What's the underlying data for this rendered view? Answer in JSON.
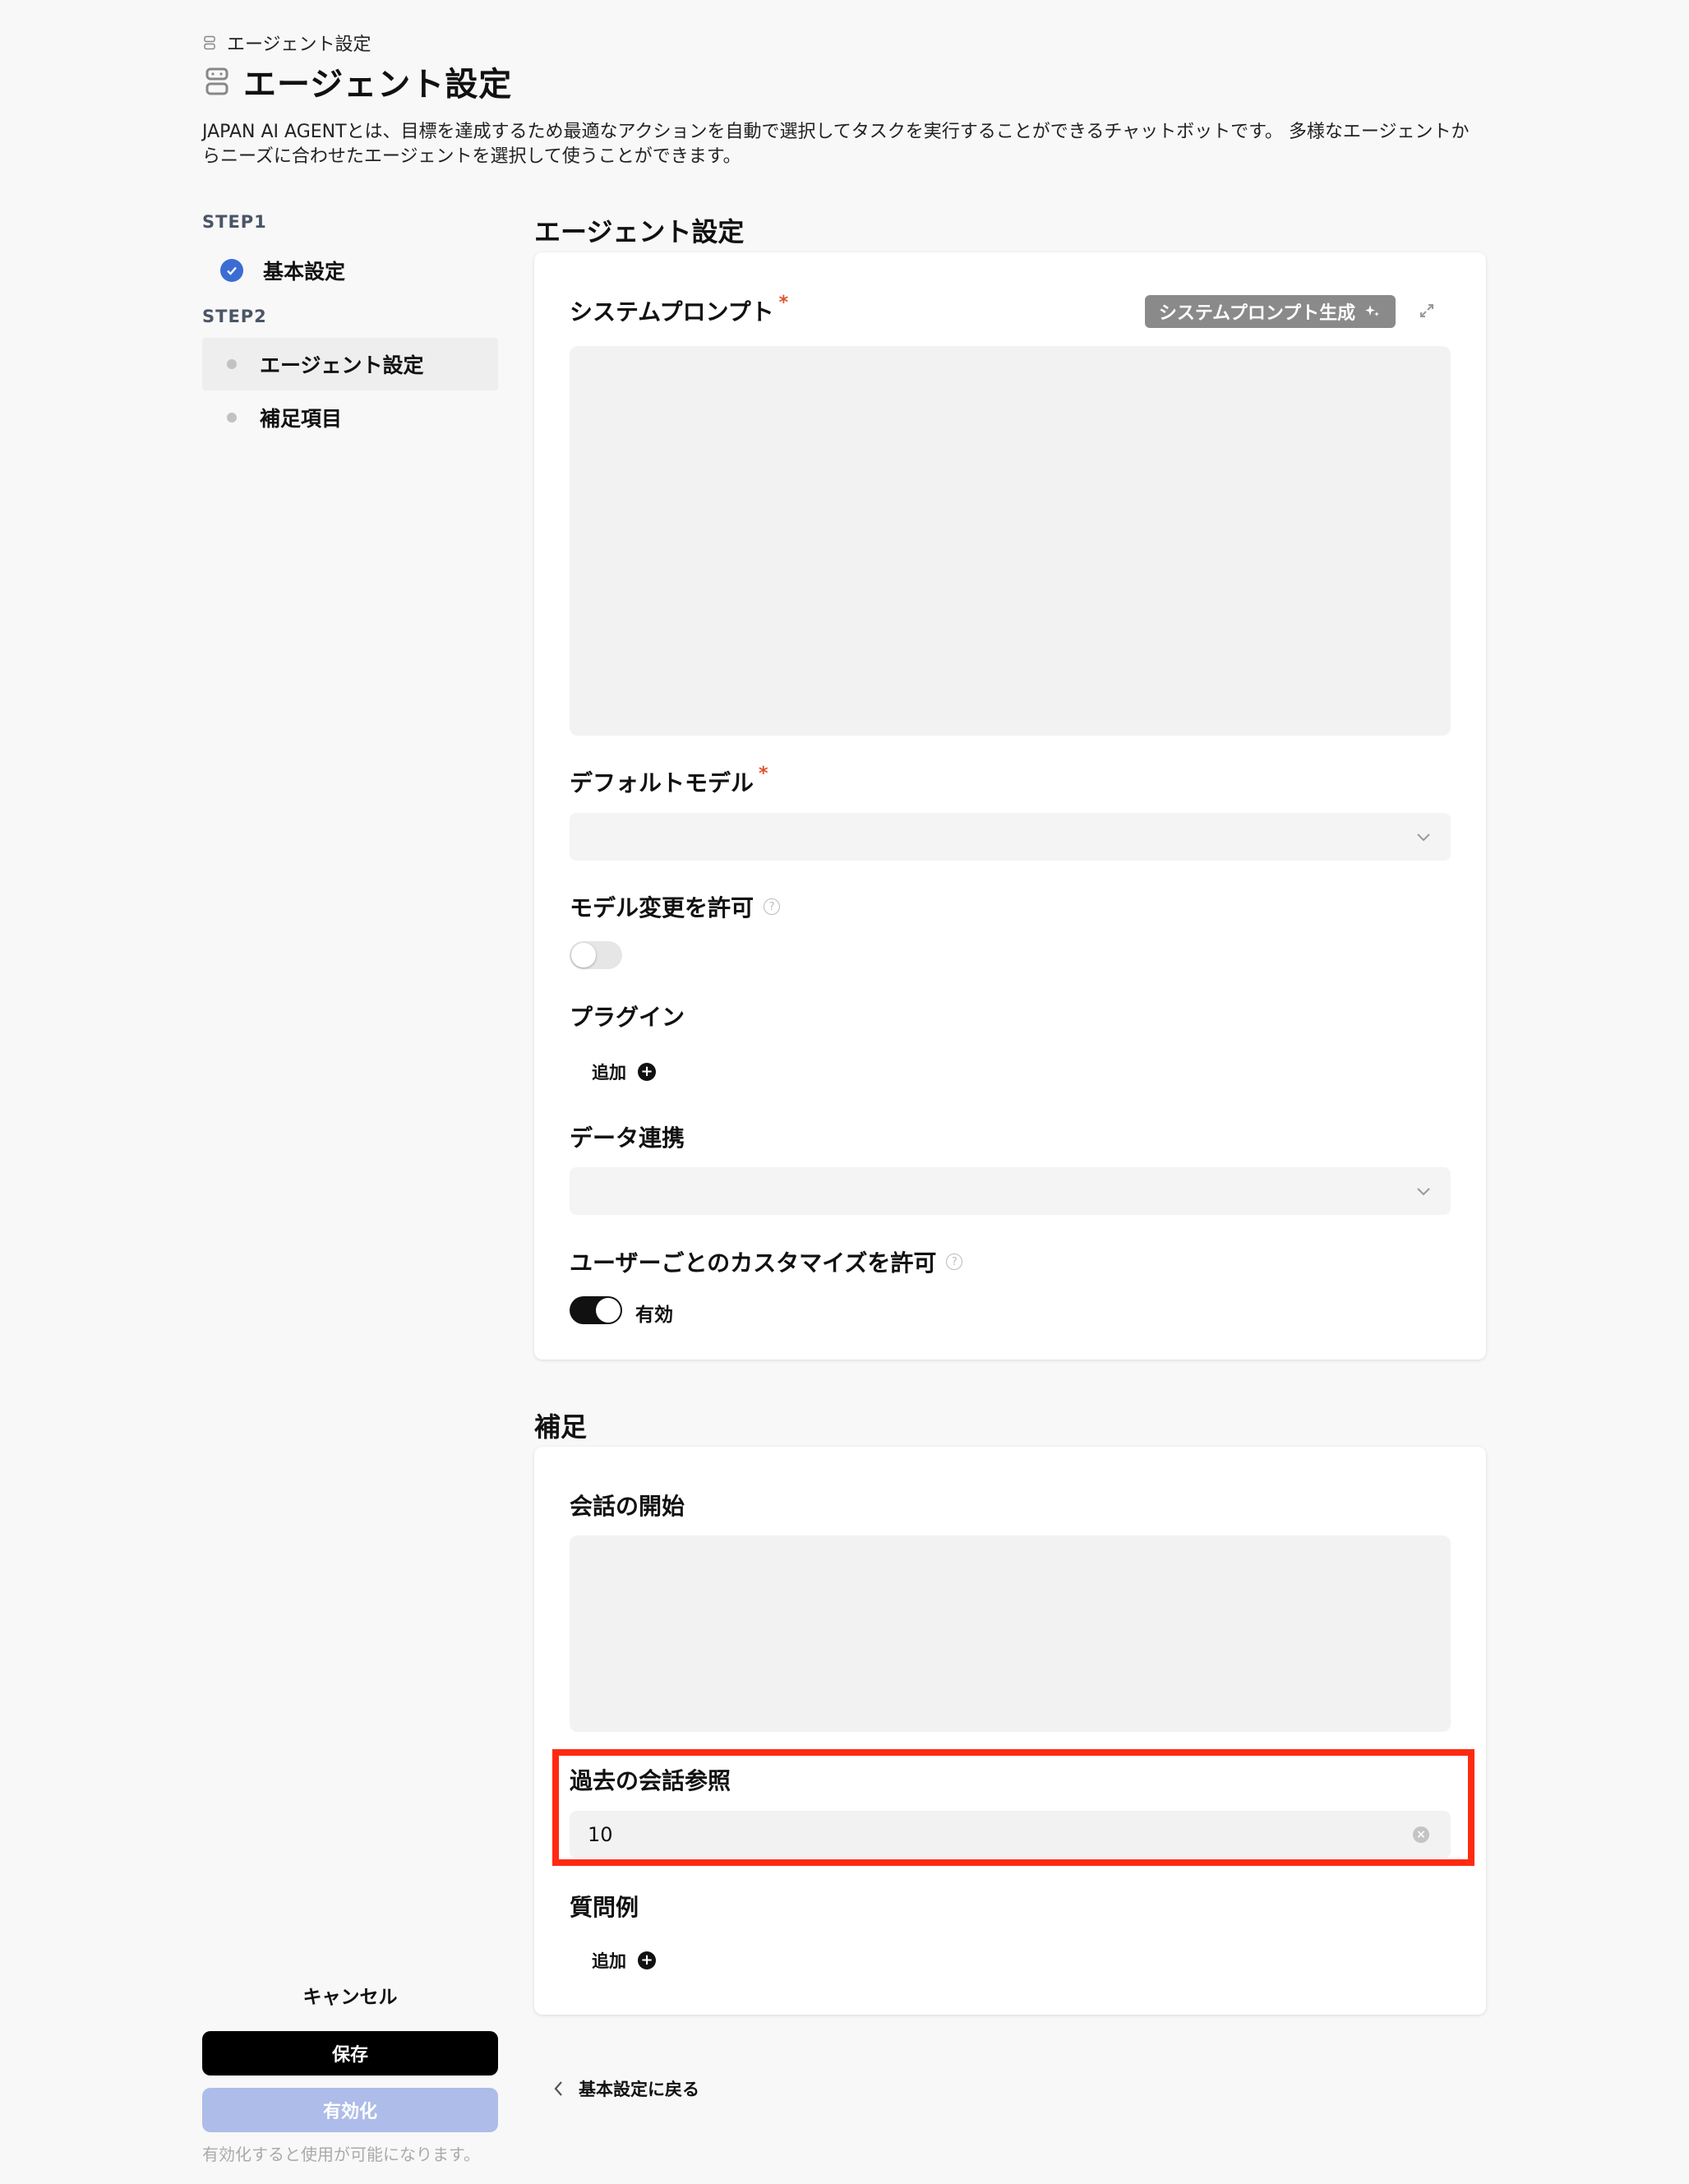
{
  "header": {
    "breadcrumb": "エージェント設定",
    "title": "エージェント設定",
    "description": "JAPAN AI AGENTとは、目標を達成するため最適なアクションを自動で選択してタスクを実行することができるチャットボットです。 多様なエージェントからニーズに合わせたエージェントを選択して使うことができます。"
  },
  "sidebar": {
    "step1_label": "STEP1",
    "step1_item": "基本設定",
    "step2_label": "STEP2",
    "step2_items": [
      {
        "label": "エージェント設定",
        "active": true
      },
      {
        "label": "補足項目",
        "active": false
      }
    ],
    "cancel_label": "キャンセル",
    "save_label": "保存",
    "activate_label": "有効化",
    "activate_hint": "有効化すると使用が可能になります。"
  },
  "agent_section": {
    "title": "エージェント設定",
    "system_prompt": {
      "label": "システムプロンプト",
      "required_mark": "*",
      "generate_button": "システムプロンプト生成",
      "value": ""
    },
    "default_model": {
      "label": "デフォルトモデル",
      "required_mark": "*",
      "selected": ""
    },
    "allow_model_change": {
      "label": "モデル変更を許可",
      "help": "?",
      "enabled": false
    },
    "plugins": {
      "label": "プラグイン",
      "add_label": "追加"
    },
    "data_link": {
      "label": "データ連携",
      "selected": ""
    },
    "user_customize": {
      "label": "ユーザーごとのカスタマイズを許可",
      "help": "?",
      "enabled": true,
      "state_text": "有効"
    }
  },
  "supplement_section": {
    "title": "補足",
    "conversation_start": {
      "label": "会話の開始",
      "value": ""
    },
    "past_reference": {
      "label": "過去の会話参照",
      "value": "10"
    },
    "sample_questions": {
      "label": "質問例",
      "add_label": "追加"
    }
  },
  "footer": {
    "back_label": "基本設定に戻る"
  },
  "colors": {
    "accent": "#3b6cd4",
    "highlight": "#ff2a12",
    "required": "#e0522f",
    "activate_disabled": "#aebce9"
  }
}
